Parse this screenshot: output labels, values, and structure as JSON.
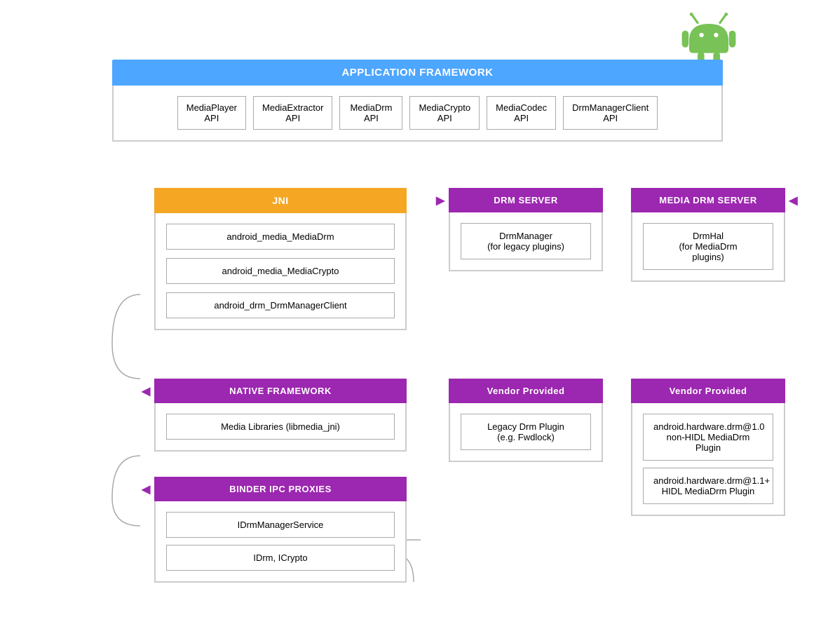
{
  "android_logo": {
    "alt": "Android Logo"
  },
  "app_framework": {
    "header": "APPLICATION FRAMEWORK",
    "apis": [
      "MediaPlayer\nAPI",
      "MediaExtractor\nAPI",
      "MediaDrm\nAPI",
      "MediaCrypto\nAPI",
      "MediaCodec\nAPI",
      "DrmManagerClient\nAPI"
    ]
  },
  "jni": {
    "header": "JNI",
    "items": [
      "android_media_MediaDrm",
      "android_media_MediaCrypto",
      "android_drm_DrmManagerClient"
    ]
  },
  "drm_server": {
    "header": "DRM SERVER",
    "items": [
      "DrmManager\n(for legacy plugins)"
    ]
  },
  "media_drm_server": {
    "header": "MEDIA DRM SERVER",
    "items": [
      "DrmHal\n(for MediaDrm\nplugins)"
    ]
  },
  "native_framework": {
    "header": "NATIVE FRAMEWORK",
    "items": [
      "Media Libraries (libmedia_jni)"
    ]
  },
  "binder_ipc": {
    "header": "BINDER IPC PROXIES",
    "items": [
      "IDrmManagerService",
      "IDrm, ICrypto"
    ]
  },
  "vendor_left": {
    "header": "Vendor Provided",
    "items": [
      "Legacy Drm Plugin\n(e.g. Fwdlock)"
    ]
  },
  "vendor_right": {
    "header": "Vendor Provided",
    "items": [
      "android.hardware.drm@1.0\nnon-HIDL MediaDrm Plugin",
      "android.hardware.drm@1.1+\nHIDL MediaDrm Plugin"
    ]
  }
}
